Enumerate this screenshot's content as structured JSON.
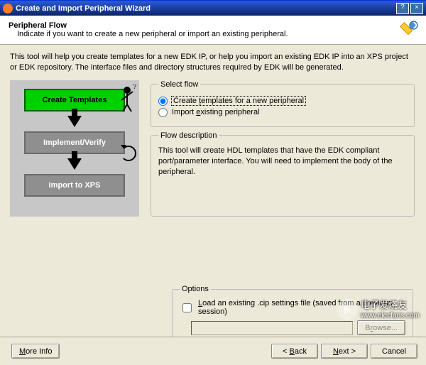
{
  "window": {
    "title": "Create and Import Peripheral Wizard",
    "help_btn": "?",
    "close_btn": "×"
  },
  "header": {
    "title": "Peripheral Flow",
    "subtitle": "Indicate if you want to create a new peripheral or import an existing peripheral."
  },
  "intro": "This tool will help you create templates for a new EDK IP, or help you import an existing EDK IP into an XPS project or EDK repository. The interface files and directory structures required by EDK will be generated.",
  "diagram": {
    "step1": "Create Templates",
    "step2": "Implement/Verify",
    "step3": "Import to XPS"
  },
  "select_flow": {
    "legend": "Select flow",
    "opt_create_pre": "Create ",
    "opt_create_u": "t",
    "opt_create_post": "emplates for a new peripheral",
    "opt_import_pre": "Import ",
    "opt_import_u": "e",
    "opt_import_post": "xisting peripheral"
  },
  "flow_desc": {
    "legend": "Flow description",
    "text": "This tool will create HDL templates that have the EDK compliant port/parameter interface. You will need to implement the body of the peripheral."
  },
  "options": {
    "legend": "Options",
    "check_pre": "",
    "check_u": "L",
    "check_post": "oad an existing .cip settings file (saved from a previous session)",
    "browse_pre": "B",
    "browse_u": "r",
    "browse_post": "owse..."
  },
  "footer": {
    "more_pre": "",
    "more_u": "M",
    "more_post": "ore Info",
    "back_pre": "< ",
    "back_u": "B",
    "back_post": "ack",
    "next_pre": "",
    "next_u": "N",
    "next_post": "ext >",
    "cancel": "Cancel"
  },
  "watermark": {
    "name": "电子发烧友",
    "url": "www.elecfans.com"
  }
}
